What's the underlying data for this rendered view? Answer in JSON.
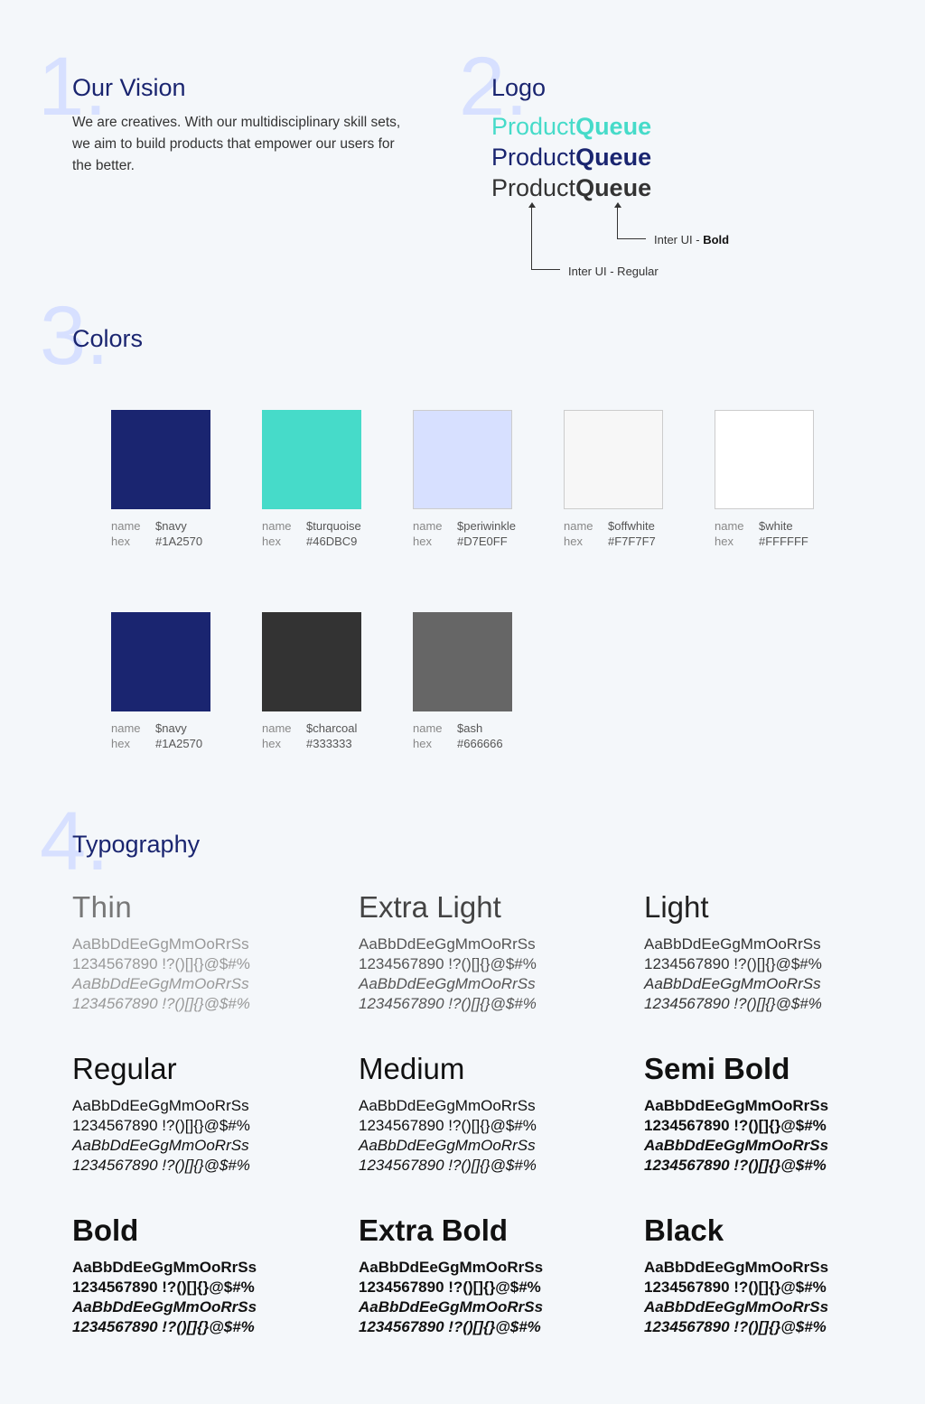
{
  "sections": {
    "vision": {
      "number": "1.",
      "title": "Our Vision",
      "body": "We are creatives. With our multidisciplinary skill sets, we aim to build products that empower our users for the better."
    },
    "logo": {
      "number": "2.",
      "title": "Logo",
      "product_regular": "Product",
      "product_bold": "Queue",
      "variant_colors": [
        "#46DBC9",
        "#1A2570",
        "#333333"
      ],
      "annotation_bold_prefix": "Inter UI - ",
      "annotation_bold_weight": "Bold",
      "annotation_regular": "Inter UI - Regular"
    },
    "colors": {
      "number": "3.",
      "title": "Colors",
      "name_label": "name",
      "hex_label": "hex",
      "swatches": [
        {
          "name": "$navy",
          "hex": "#1A2570"
        },
        {
          "name": "$turquoise",
          "hex": "#46DBC9"
        },
        {
          "name": "$periwinkle",
          "hex": "#D7E0FF"
        },
        {
          "name": "$offwhite",
          "hex": "#F7F7F7"
        },
        {
          "name": "$white",
          "hex": "#FFFFFF"
        },
        {
          "name": "$navy",
          "hex": "#1A2570"
        },
        {
          "name": "$charcoal",
          "hex": "#333333"
        },
        {
          "name": "$ash",
          "hex": "#666666"
        }
      ]
    },
    "typography": {
      "number": "4.",
      "title": "Typography",
      "sample_letters": "AaBbDdEeGgMmOoRrSs",
      "sample_symbols": "1234567890 !?()[]{}@$#%",
      "weights": [
        {
          "label": "Thin",
          "weight": 100
        },
        {
          "label": "Extra Light",
          "weight": 200
        },
        {
          "label": "Light",
          "weight": 300
        },
        {
          "label": "Regular",
          "weight": 400
        },
        {
          "label": "Medium",
          "weight": 500
        },
        {
          "label": "Semi Bold",
          "weight": 600
        },
        {
          "label": "Bold",
          "weight": 700
        },
        {
          "label": "Extra Bold",
          "weight": 800
        },
        {
          "label": "Black",
          "weight": 900
        }
      ]
    }
  }
}
